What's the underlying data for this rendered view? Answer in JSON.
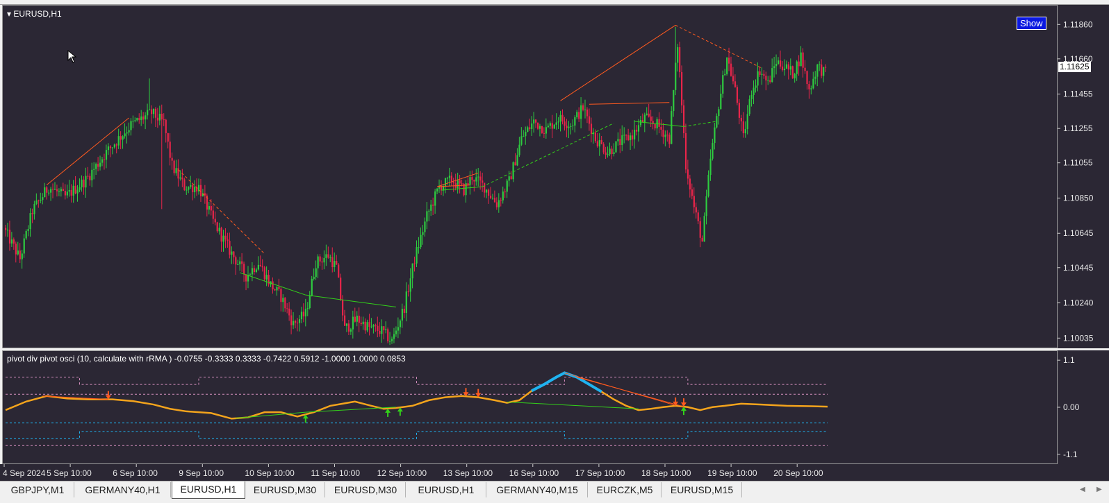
{
  "chart": {
    "symbol_title": "EURUSD,H1",
    "show_button": "Show",
    "current_price": "1.11625",
    "price_labels": [
      "1.11860",
      "1.11660",
      "1.11455",
      "1.11255",
      "1.11055",
      "1.10850",
      "1.10645",
      "1.10445",
      "1.10240",
      "1.10035"
    ],
    "date_labels": [
      "4 Sep 2024",
      "5 Sep 10:00",
      "6 Sep 10:00",
      "9 Sep 10:00",
      "10 Sep 10:00",
      "11 Sep 10:00",
      "12 Sep 10:00",
      "13 Sep 10:00",
      "16 Sep 10:00",
      "17 Sep 10:00",
      "18 Sep 10:00",
      "19 Sep 10:00",
      "20 Sep 10:00"
    ],
    "colors": {
      "background": "#2b2734",
      "bull": "#2ecc40",
      "bear": "#e8254a",
      "divergence_bear": "#ff5a1f",
      "divergence_bull": "#33d11a",
      "osc_line": "#f4a41c",
      "osc_peak": "#1fb3f0"
    }
  },
  "oscillator": {
    "title": "pivot div pivot osci (10, calculate with rRMA ) -0.0755 -0.3333 0.3333 -0.7422 0.5912 -1.0000 1.0000 0.0853",
    "axis_labels": [
      "1.1",
      "0.00",
      "-1.1"
    ]
  },
  "tabs": [
    {
      "label": "GBPJPY,M1",
      "active": false
    },
    {
      "label": "GERMANY40,H1",
      "active": false
    },
    {
      "label": "EURUSD,H1",
      "active": true
    },
    {
      "label": "EURUSD,M30",
      "active": false
    },
    {
      "label": "EURUSD,M30",
      "active": false
    },
    {
      "label": "EURUSD,H1",
      "active": false
    },
    {
      "label": "GERMANY40,M15",
      "active": false
    },
    {
      "label": "EURCZK,M5",
      "active": false
    },
    {
      "label": "EURUSD,M15",
      "active": false
    }
  ],
  "chart_data": {
    "type": "candlestick",
    "title": "EURUSD,H1",
    "ylim": [
      1.1,
      1.1195
    ],
    "price_anchors": [
      [
        0,
        1.1068
      ],
      [
        8,
        1.105
      ],
      [
        14,
        1.1078
      ],
      [
        22,
        1.1092
      ],
      [
        30,
        1.1086
      ],
      [
        40,
        1.1096
      ],
      [
        50,
        1.1112
      ],
      [
        62,
        1.1128
      ],
      [
        72,
        1.1135
      ],
      [
        78,
        1.1129
      ],
      [
        82,
        1.1104
      ],
      [
        88,
        1.1092
      ],
      [
        95,
        1.1092
      ],
      [
        102,
        1.1072
      ],
      [
        110,
        1.1055
      ],
      [
        118,
        1.104
      ],
      [
        124,
        1.1048
      ],
      [
        130,
        1.1035
      ],
      [
        135,
        1.1028
      ],
      [
        141,
        1.1012
      ],
      [
        147,
        1.1018
      ],
      [
        152,
        1.1048
      ],
      [
        158,
        1.1052
      ],
      [
        162,
        1.1045
      ],
      [
        166,
        1.1009
      ],
      [
        172,
        1.1015
      ],
      [
        178,
        1.101
      ],
      [
        184,
        1.1008
      ],
      [
        189,
        1.1002
      ],
      [
        195,
        1.1022
      ],
      [
        200,
        1.105
      ],
      [
        206,
        1.1075
      ],
      [
        212,
        1.1092
      ],
      [
        218,
        1.1096
      ],
      [
        224,
        1.109
      ],
      [
        228,
        1.1098
      ],
      [
        234,
        1.1092
      ],
      [
        240,
        1.1082
      ],
      [
        246,
        1.1095
      ],
      [
        252,
        1.112
      ],
      [
        258,
        1.113
      ],
      [
        264,
        1.1125
      ],
      [
        270,
        1.1132
      ],
      [
        276,
        1.1128
      ],
      [
        282,
        1.1138
      ],
      [
        288,
        1.112
      ],
      [
        294,
        1.1112
      ],
      [
        300,
        1.1118
      ],
      [
        306,
        1.1122
      ],
      [
        312,
        1.1132
      ],
      [
        318,
        1.1128
      ],
      [
        324,
        1.112
      ],
      [
        328,
        1.1175
      ],
      [
        332,
        1.1105
      ],
      [
        336,
        1.108
      ],
      [
        340,
        1.106
      ],
      [
        344,
        1.1108
      ],
      [
        348,
        1.114
      ],
      [
        352,
        1.1168
      ],
      [
        356,
        1.1148
      ],
      [
        360,
        1.112
      ],
      [
        364,
        1.1148
      ],
      [
        368,
        1.116
      ],
      [
        372,
        1.1152
      ],
      [
        376,
        1.1165
      ],
      [
        380,
        1.1162
      ],
      [
        384,
        1.1158
      ],
      [
        388,
        1.1168
      ],
      [
        392,
        1.1148
      ],
      [
        396,
        1.1162
      ],
      [
        400,
        1.1158
      ]
    ],
    "spikes": [
      [
        70,
        1.1155
      ],
      [
        326,
        1.1185
      ],
      [
        340,
        1.1062
      ],
      [
        76,
        1.1079
      ]
    ],
    "divergence_lines": [
      {
        "color": "bear",
        "style": "solid",
        "from": [
          20,
          1.1093
        ],
        "to": [
          60,
          1.1132
        ]
      },
      {
        "color": "bear",
        "style": "dashed",
        "from": [
          84,
          1.1102
        ],
        "to": [
          126,
          1.1053
        ]
      },
      {
        "color": "bull",
        "style": "solid",
        "from": [
          114,
          1.1042
        ],
        "to": [
          146,
          1.1029
        ]
      },
      {
        "color": "bull",
        "style": "solid",
        "from": [
          146,
          1.1029
        ],
        "to": [
          190,
          1.1022
        ]
      },
      {
        "color": "bear",
        "style": "solid",
        "from": [
          210,
          1.1092
        ],
        "to": [
          230,
          1.11
        ]
      },
      {
        "color": "bear",
        "style": "solid",
        "from": [
          210,
          1.1092
        ],
        "to": [
          226,
          1.1093
        ]
      },
      {
        "color": "bull",
        "style": "solid",
        "from": [
          212,
          1.109
        ],
        "to": [
          232,
          1.1092
        ]
      },
      {
        "color": "bull",
        "style": "dashed",
        "from": [
          232,
          1.1092
        ],
        "to": [
          296,
          1.1129
        ]
      },
      {
        "color": "bear",
        "style": "solid",
        "from": [
          270,
          1.1142
        ],
        "to": [
          326,
          1.1186
        ]
      },
      {
        "color": "bear",
        "style": "dashed",
        "from": [
          326,
          1.1186
        ],
        "to": [
          368,
          1.1161
        ]
      },
      {
        "color": "bear",
        "style": "solid",
        "from": [
          284,
          1.114
        ],
        "to": [
          323,
          1.1141
        ]
      },
      {
        "color": "bull",
        "style": "solid",
        "from": [
          306,
          1.113
        ],
        "to": [
          330,
          1.1127
        ]
      },
      {
        "color": "bull",
        "style": "dashed",
        "from": [
          330,
          1.1127
        ],
        "to": [
          346,
          1.113
        ]
      }
    ],
    "oscillator": {
      "ylim": [
        -1.2,
        1.2
      ],
      "levels": {
        "zero": 0.0,
        "upper_band": 0.35,
        "lower_band": -0.35
      },
      "line": [
        [
          0,
          -0.05
        ],
        [
          10,
          0.15
        ],
        [
          20,
          0.28
        ],
        [
          30,
          0.22
        ],
        [
          40,
          0.2
        ],
        [
          52,
          0.2
        ],
        [
          62,
          0.16
        ],
        [
          72,
          0.08
        ],
        [
          80,
          -0.02
        ],
        [
          88,
          -0.08
        ],
        [
          100,
          -0.12
        ],
        [
          110,
          -0.25
        ],
        [
          118,
          -0.22
        ],
        [
          126,
          -0.1
        ],
        [
          134,
          -0.1
        ],
        [
          142,
          -0.2
        ],
        [
          150,
          -0.1
        ],
        [
          158,
          0.05
        ],
        [
          164,
          0.1
        ],
        [
          170,
          0.15
        ],
        [
          178,
          0.05
        ],
        [
          184,
          -0.02
        ],
        [
          190,
          0.0
        ],
        [
          198,
          0.05
        ],
        [
          206,
          0.18
        ],
        [
          214,
          0.25
        ],
        [
          222,
          0.28
        ],
        [
          230,
          0.25
        ],
        [
          238,
          0.18
        ],
        [
          244,
          0.12
        ],
        [
          250,
          0.18
        ],
        [
          256,
          0.4
        ],
        [
          262,
          0.55
        ],
        [
          268,
          0.72
        ],
        [
          272,
          0.82
        ],
        [
          278,
          0.72
        ],
        [
          284,
          0.55
        ],
        [
          290,
          0.38
        ],
        [
          296,
          0.2
        ],
        [
          302,
          0.05
        ],
        [
          308,
          -0.05
        ],
        [
          314,
          -0.02
        ],
        [
          320,
          0.02
        ],
        [
          326,
          0.05
        ],
        [
          332,
          0.02
        ],
        [
          338,
          -0.05
        ],
        [
          344,
          0.02
        ],
        [
          350,
          0.05
        ],
        [
          358,
          0.1
        ],
        [
          368,
          0.08
        ],
        [
          380,
          0.05
        ],
        [
          392,
          0.04
        ],
        [
          400,
          0.03
        ]
      ],
      "peak_segment": [
        256,
        290
      ],
      "bands": [
        {
          "style": "dashed",
          "color": "#d68fbf",
          "points": [
            [
              0,
              0.72
            ],
            [
              36,
              0.72
            ],
            [
              36,
              0.55
            ],
            [
              94,
              0.55
            ],
            [
              94,
              0.72
            ],
            [
              200,
              0.72
            ],
            [
              200,
              0.55
            ],
            [
              272,
              0.55
            ],
            [
              272,
              0.72
            ],
            [
              332,
              0.72
            ],
            [
              332,
              0.55
            ],
            [
              400,
              0.55
            ]
          ]
        },
        {
          "style": "dashed",
          "color": "#d68fbf",
          "points": [
            [
              0,
              0.32
            ],
            [
              400,
              0.32
            ]
          ]
        },
        {
          "style": "dashed",
          "color": "#1fb3f0",
          "points": [
            [
              0,
              -0.35
            ],
            [
              400,
              -0.35
            ]
          ]
        },
        {
          "style": "dashed",
          "color": "#1fb3f0",
          "points": [
            [
              0,
              -0.72
            ],
            [
              36,
              -0.72
            ],
            [
              36,
              -0.55
            ],
            [
              94,
              -0.55
            ],
            [
              94,
              -0.72
            ],
            [
              200,
              -0.72
            ],
            [
              200,
              -0.55
            ],
            [
              272,
              -0.55
            ],
            [
              272,
              -0.72
            ],
            [
              332,
              -0.72
            ],
            [
              332,
              -0.55
            ],
            [
              400,
              -0.55
            ]
          ]
        },
        {
          "style": "dashed",
          "color": "#d68fbf",
          "points": [
            [
              0,
              -0.88
            ],
            [
              400,
              -0.88
            ]
          ]
        }
      ],
      "div_lines": [
        {
          "color": "bear",
          "from": [
            18,
            0.28
          ],
          "to": [
            50,
            0.2
          ]
        },
        {
          "color": "bull",
          "from": [
            112,
            -0.24
          ],
          "to": [
            146,
            -0.1
          ]
        },
        {
          "color": "bull",
          "from": [
            146,
            -0.1
          ],
          "to": [
            190,
            0.02
          ]
        },
        {
          "color": "bear",
          "from": [
            272,
            0.82
          ],
          "to": [
            326,
            0.06
          ]
        },
        {
          "color": "bear",
          "from": [
            278,
            0.72
          ],
          "to": [
            330,
            0.03
          ]
        },
        {
          "color": "bull",
          "from": [
            244,
            0.14
          ],
          "to": [
            308,
            -0.02
          ]
        }
      ],
      "down_arrows": [
        50,
        224,
        230,
        326,
        330
      ],
      "up_arrows": [
        146,
        186,
        192,
        330
      ]
    }
  }
}
